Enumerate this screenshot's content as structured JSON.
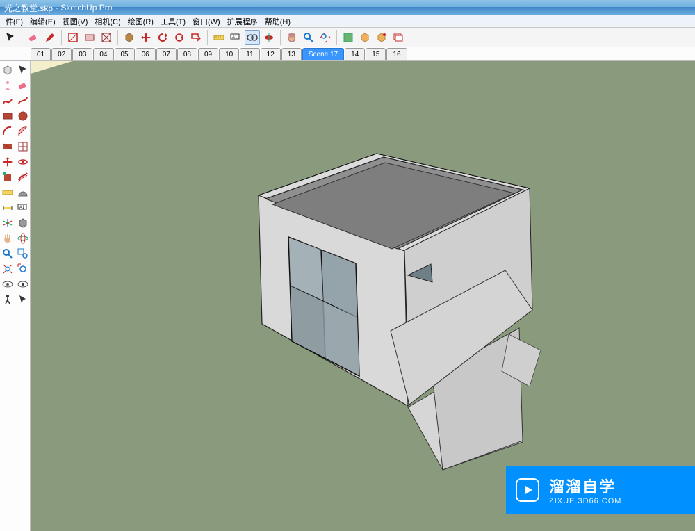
{
  "title": {
    "filename": "光之教堂.skp",
    "appname": "- SketchUp Pro"
  },
  "menu": {
    "file": "件(F)",
    "edit": "编辑(E)",
    "view": "视图(V)",
    "camera": "相机(C)",
    "draw": "绘图(R)",
    "tools": "工具(T)",
    "window": "窗口(W)",
    "ext": "扩展程序",
    "help": "帮助(H)"
  },
  "scenes": {
    "tabs": [
      "01",
      "02",
      "03",
      "04",
      "05",
      "06",
      "07",
      "08",
      "09",
      "10",
      "11",
      "12",
      "13",
      "Scene 17",
      "14",
      "15",
      "16"
    ],
    "active": "Scene 17"
  },
  "toolbar": {
    "names": [
      "select",
      "eraser",
      "pencil",
      "line",
      "rect",
      "arc",
      "pushpull",
      "move",
      "rotate",
      "scale",
      "offset",
      "follow",
      "tape",
      "text",
      "dimension",
      "protractor",
      "axes",
      "pan",
      "zoom",
      "zoom-extents",
      "orbit",
      "undo",
      "redo",
      "paint",
      "component"
    ]
  },
  "watermark": {
    "cn": "溜溜自学",
    "url": "ZIXUE.3D66.COM"
  }
}
